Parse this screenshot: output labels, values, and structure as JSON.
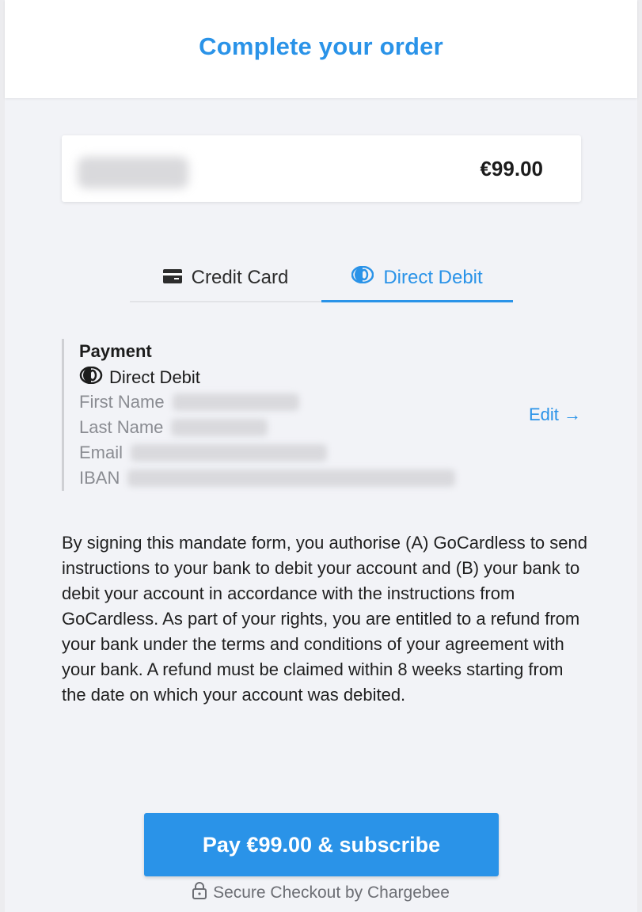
{
  "header": {
    "title": "Complete your order"
  },
  "summary": {
    "price": "€99.00"
  },
  "tabs": [
    {
      "label": "Credit Card",
      "icon": "credit-card-icon",
      "active": false
    },
    {
      "label": "Direct Debit",
      "icon": "direct-debit-icon",
      "active": true
    }
  ],
  "payment": {
    "title": "Payment",
    "method": "Direct Debit",
    "fields": {
      "first_name": "First Name",
      "last_name": "Last Name",
      "email": "Email",
      "iban": "IBAN"
    },
    "edit_label": "Edit →"
  },
  "mandate_text": "By signing this mandate form, you authorise (A) GoCardless to send instructions to your bank to debit your account and (B) your bank to debit your account in accordance with the instructions from GoCardless. As part of your rights, you are entitled to a refund from your bank under the terms and conditions of your agreement with your bank. A refund must be claimed within 8 weeks starting from the date on which your account was debited.",
  "pay_button": "Pay €99.00 & subscribe",
  "secure_text": "Secure Checkout by Chargebee",
  "colors": {
    "accent": "#2a93e8",
    "background": "#f2f3f7"
  }
}
